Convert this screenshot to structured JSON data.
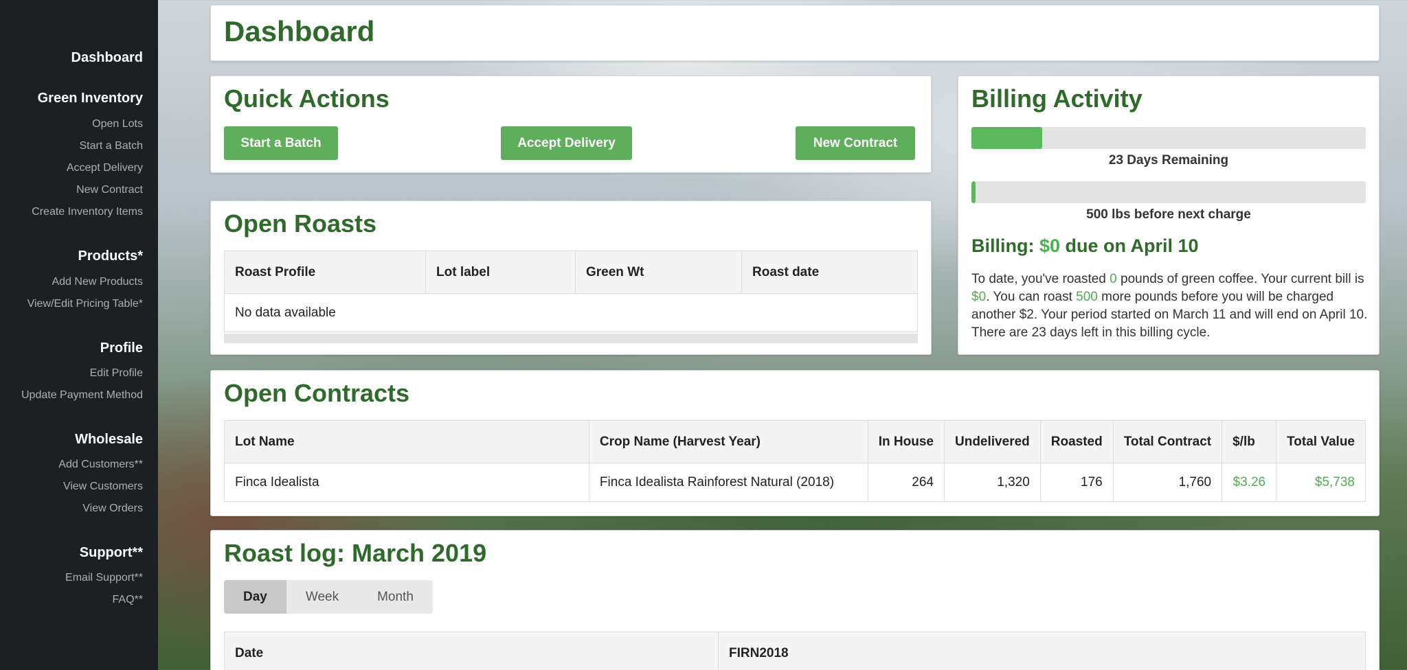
{
  "sidebar": {
    "dashboard": "Dashboard",
    "green_inventory": {
      "title": "Green Inventory",
      "items": [
        "Open Lots",
        "Start a Batch",
        "Accept Delivery",
        "New Contract",
        "Create Inventory Items"
      ]
    },
    "products": {
      "title": "Products*",
      "items": [
        "Add New Products",
        "View/Edit Pricing Table*"
      ]
    },
    "profile": {
      "title": "Profile",
      "items": [
        "Edit Profile",
        "Update Payment Method"
      ]
    },
    "wholesale": {
      "title": "Wholesale",
      "items": [
        "Add Customers**",
        "View Customers",
        "View Orders"
      ]
    },
    "support": {
      "title": "Support**",
      "items": [
        "Email Support**",
        "FAQ**"
      ]
    }
  },
  "header": {
    "title": "Dashboard"
  },
  "quick_actions": {
    "title": "Quick Actions",
    "buttons": [
      "Start a Batch",
      "Accept Delivery",
      "New Contract"
    ]
  },
  "billing": {
    "title": "Billing Activity",
    "days_remaining_label": "23 Days Remaining",
    "days_progress": 0.18,
    "lbs_label": "500 lbs before next charge",
    "lbs_progress": 0.01,
    "due_prefix": "Billing: ",
    "due_amount": "$0",
    "due_suffix": " due on April 10",
    "summary": {
      "p1": "To date, you've roasted ",
      "roasted": "0",
      "p2": " pounds of green coffee. Your current bill is ",
      "bill": "$0",
      "p3": ". You can roast ",
      "can_roast": "500",
      "p4": " more pounds before you will be charged another $2. Your period started on March 11 and will end on April 10. There are 23 days left in this billing cycle."
    },
    "colors": {
      "accent": "#5cb85c",
      "track": "#e3e3e3"
    }
  },
  "open_roasts": {
    "title": "Open Roasts",
    "columns": [
      "Roast Profile",
      "Lot label",
      "Green Wt",
      "Roast date"
    ],
    "empty_text": "No data available"
  },
  "open_contracts": {
    "title": "Open Contracts",
    "columns": [
      "Lot Name",
      "Crop Name (Harvest Year)",
      "In House",
      "Undelivered",
      "Roasted",
      "Total Contract",
      "$/lb",
      "Total Value"
    ],
    "rows": [
      [
        "Finca Idealista",
        "Finca Idealista Rainforest Natural (2018)",
        "264",
        "1,320",
        "176",
        "1,760",
        "$3.26",
        "$5,738"
      ]
    ]
  },
  "roast_log": {
    "title": "Roast log: March 2019",
    "tabs": [
      "Day",
      "Week",
      "Month"
    ],
    "active_tab": "Day",
    "columns": [
      "Date",
      "FIRN2018"
    ]
  },
  "theme": {
    "brand_green": "#2e6b2b",
    "button_green": "#5fae5b",
    "sidebar_bg": "#1c2022"
  }
}
